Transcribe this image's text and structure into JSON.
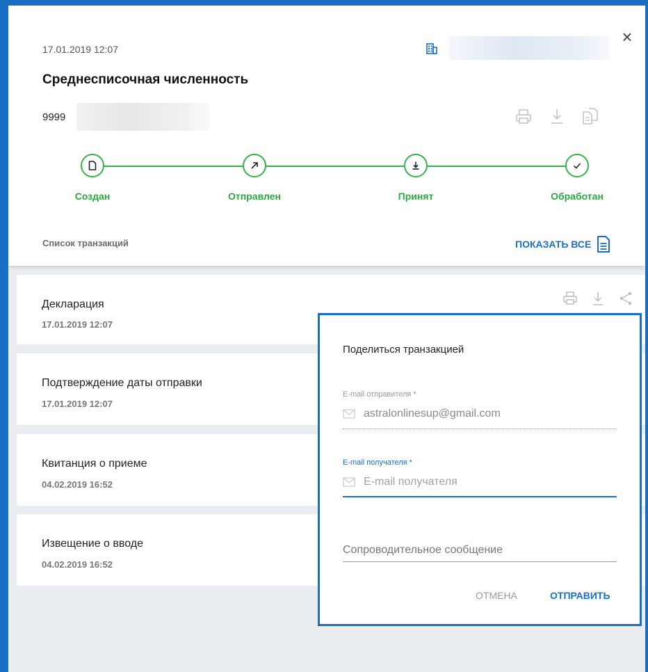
{
  "document": {
    "date": "17.01.2019 12:07",
    "title": "Среднесписочная численность",
    "reg_number": "9999",
    "close_symbol": "×"
  },
  "icons": {
    "org": "building-icon",
    "close": "close-icon",
    "print": "printer-icon",
    "download": "download-icon",
    "copy": "copy-document-icon",
    "share": "share-icon",
    "show_all": "document-list-icon",
    "email": "envelope-icon"
  },
  "status_steps": [
    {
      "label": "Создан",
      "icon": "document-icon"
    },
    {
      "label": "Отправлен",
      "icon": "arrow-up-right-icon"
    },
    {
      "label": "Принят",
      "icon": "download-icon"
    },
    {
      "label": "Обработан",
      "icon": "check-icon"
    }
  ],
  "transactions": {
    "label": "Список транзакций",
    "show_all": "ПОКАЗАТЬ ВСЕ",
    "items": [
      {
        "name": "Декларация",
        "date": "17.01.2019 12:07"
      },
      {
        "name": "Подтверждение даты отправки",
        "date": "17.01.2019 12:07"
      },
      {
        "name": "Квитанция о приеме",
        "date": "04.02.2019 16:52"
      },
      {
        "name": "Извещение о вводе",
        "date": "04.02.2019 16:52"
      }
    ]
  },
  "share_dialog": {
    "title": "Поделиться транзакцией",
    "sender_label": "E-mail отправителя *",
    "sender_value": "astralonlinesup@gmail.com",
    "recipient_label": "E-mail получателя *",
    "recipient_placeholder": "E-mail получателя",
    "message_placeholder": "Сопроводительное сообщение",
    "cancel": "ОТМЕНА",
    "send": "ОТПРАВИТЬ"
  },
  "colors": {
    "accent": "#1a6fc4",
    "success": "#35b34a",
    "background": "#eaeef2"
  }
}
